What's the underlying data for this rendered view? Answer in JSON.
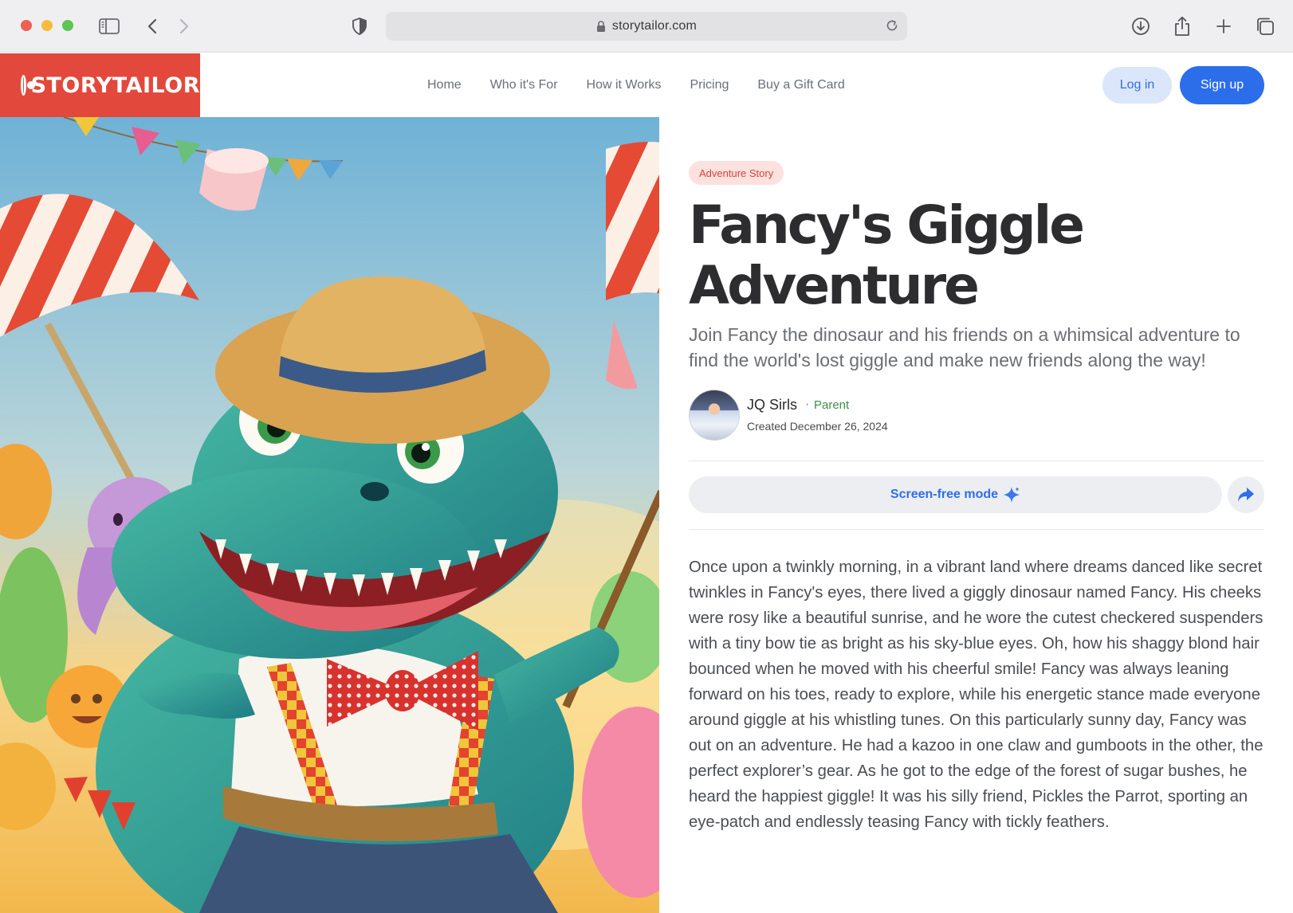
{
  "browser": {
    "url": "storytailor.com"
  },
  "site": {
    "brand": "STORYTAILOR",
    "nav": [
      "Home",
      "Who it's For",
      "How it Works",
      "Pricing",
      "Buy a Gift Card"
    ],
    "login_label": "Log in",
    "signup_label": "Sign up",
    "accent_color": "#e2493c",
    "primary_color": "#2c6eea"
  },
  "story": {
    "tag": "Adventure Story",
    "title_line1": "Fancy's Giggle",
    "title_line2": "Adventure",
    "subtitle": "Join Fancy the dinosaur and his friends on a whimsical adventure to find the world's lost giggle and make new friends along the way!",
    "author": {
      "name": "JQ Sirls",
      "separator": "·",
      "role": "Parent",
      "created": "Created December 26, 2024"
    },
    "screen_free_label": "Screen-free mode",
    "body": "Once upon a twinkly morning, in a vibrant land where dreams danced like secret twinkles in Fancy's eyes, there lived a giggly dinosaur named Fancy. His cheeks were rosy like a beautiful sunrise, and he wore the cutest checkered suspenders with a tiny bow tie as bright as his sky-blue eyes. Oh, how his shaggy blond hair bounced when he moved with his cheerful smile! Fancy was always leaning forward on his toes, ready to explore, while his energetic stance made everyone around giggle at his whistling tunes. On this particularly sunny day, Fancy was out on an adventure. He had a kazoo in one claw and gumboots in the other, the perfect explorer’s gear. As he got to the edge of the forest of sugar bushes, he heard the happiest giggle! It was his silly friend, Pickles the Parrot, sporting an eye-patch and endlessly teasing Fancy with tickly feathers."
  }
}
